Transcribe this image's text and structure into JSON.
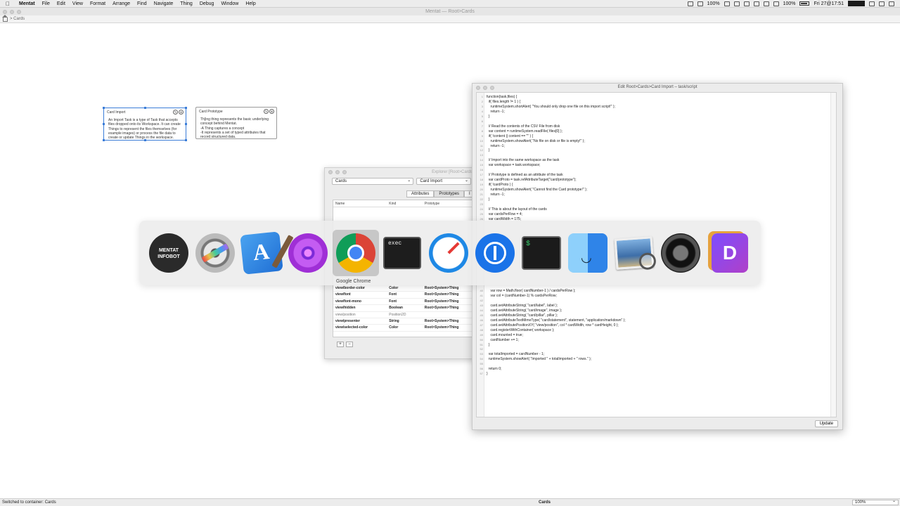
{
  "menubar": {
    "app_name": "Mentat",
    "items": [
      "File",
      "Edit",
      "View",
      "Format",
      "Arrange",
      "Find",
      "Navigate",
      "Thing",
      "Debug",
      "Window",
      "Help"
    ],
    "status": {
      "zoom": "100%",
      "battery": "100%",
      "datetime": "Fri 27@17:51"
    }
  },
  "window": {
    "title": "Mentat — Root>Cards",
    "breadcrumb": "> Cards"
  },
  "cards": [
    {
      "title": "Card Import",
      "body": [
        "An Import Task is a type of Task that accepts",
        "files dropped onto its Workspace. It can create",
        "Things to represent the files themselves (for",
        "example images) or process the file data to",
        "create or update Things in the workspace."
      ]
    },
    {
      "title": "Card Prototype",
      "body": [
        "Th[ing thing represents the basic underlying",
        "concept behind Mentat.",
        "-A Thing captures a concept",
        "-It represents a set of typed attributes that",
        "record structured data."
      ]
    }
  ],
  "explorer": {
    "title": "Explorer [Root>Cards",
    "select_left": "Cards",
    "select_right": "Card Import",
    "tabs": [
      "Attributes",
      "Prototypes",
      "I"
    ],
    "columns": [
      "Name",
      "Kind",
      "Prototype"
    ],
    "rows": [
      {
        "name": "view/border-color",
        "kind": "Color",
        "proto": "Root>System>Thing",
        "style": "bold"
      },
      {
        "name": "view/font",
        "kind": "Font",
        "proto": "Root>System>Thing",
        "style": "bold"
      },
      {
        "name": "view/font-mono",
        "kind": "Font",
        "proto": "Root>System>Thing",
        "style": "bold"
      },
      {
        "name": "view/hidden",
        "kind": "Boolean",
        "proto": "Root>System>Thing",
        "style": "bold"
      },
      {
        "name": "view/position",
        "kind": "Position2D",
        "proto": "",
        "style": "dim"
      },
      {
        "name": "view/presenter",
        "kind": "String",
        "proto": "Root>System>Thing",
        "style": "bold"
      },
      {
        "name": "view/selected-color",
        "kind": "Color",
        "proto": "Root>System>Thing",
        "style": "bold"
      }
    ],
    "add_label": "+",
    "remove_label": "−"
  },
  "editor": {
    "title": "Edit Root>Cards>Card Import – task/script",
    "lines": [
      {
        "n": "1",
        "t": "function(task,files) {"
      },
      {
        "n": "2",
        "t": "  if( files.length != 1 ) {"
      },
      {
        "n": "3",
        "t": "    runtimeSystem.shortAlert( \"You should only drop one file on this import script!\" );"
      },
      {
        "n": "4",
        "t": "    return -1;"
      },
      {
        "n": "5",
        "t": "  }"
      },
      {
        "n": "6",
        "t": ""
      },
      {
        "n": "7",
        "t": "  // Read the contents of the CSV File from disk"
      },
      {
        "n": "8",
        "t": "  var content = runtimeSystem.readFile( files[0] );"
      },
      {
        "n": "9",
        "t": "  if( !content || content == \"\" ) {"
      },
      {
        "n": "10",
        "t": "    runtimeSystem.showAlert( \"No file on disk or file is empty!\" );"
      },
      {
        "n": "11",
        "t": "    return -1;"
      },
      {
        "n": "12",
        "t": "  }"
      },
      {
        "n": "13",
        "t": ""
      },
      {
        "n": "14",
        "t": "  // Import into the same workspace as the task"
      },
      {
        "n": "15",
        "t": "  var workspace = task.workspace;"
      },
      {
        "n": "16",
        "t": ""
      },
      {
        "n": "17",
        "t": "  // Prototype is defined as an attribute of the task"
      },
      {
        "n": "18",
        "t": "  var cardProto = task.refAttributeTarget(\"card/prototype\");"
      },
      {
        "n": "19",
        "t": "  if( !cardProto ) {"
      },
      {
        "n": "20",
        "t": "    runtimeSystem.showAlert( \"Cannot find the Card prototype!\" );"
      },
      {
        "n": "21",
        "t": "    return -1;"
      },
      {
        "n": "22",
        "t": "  }"
      },
      {
        "n": "23",
        "t": ""
      },
      {
        "n": "24",
        "t": "  // This is about the layout of the cards"
      },
      {
        "n": "25",
        "t": "  var cardsPerRow = 4;"
      },
      {
        "n": "26",
        "t": "  var cardWidth = 175;"
      },
      {
        "n": "40",
        "t": "    var row = Math.floor( cardNumber-1 ) / cardsPerRow );"
      },
      {
        "n": "41",
        "t": "    var col = (cardNumber-1) % cardsPerRow;"
      },
      {
        "n": "42",
        "t": ""
      },
      {
        "n": "43",
        "t": "    card.setAttributeString( \"card/label\", label );"
      },
      {
        "n": "44",
        "t": "    card.setAttributeString( \"card/image\", image );"
      },
      {
        "n": "45",
        "t": "    card.setAttributeString( \"card/pillar\", pillar );"
      },
      {
        "n": "46",
        "t": "    card.setAttributeTextMimeType( \"card/statement\", statement, \"application/markdown\" );"
      },
      {
        "n": "47",
        "t": "    card.setAttributePositionXY( \"view/position\", col * cardWidth, row * cardHeight, 0 );"
      },
      {
        "n": "48",
        "t": "    card.registerWithContainer( workspace );"
      },
      {
        "n": "49",
        "t": "    card.mounted = true;"
      },
      {
        "n": "50",
        "t": "    cardNumber += 1;"
      },
      {
        "n": "51",
        "t": "  }"
      },
      {
        "n": "52",
        "t": ""
      },
      {
        "n": "53",
        "t": "  var totalImported = cardNumber - 1;"
      },
      {
        "n": "54",
        "t": "  runtimeSystem.showAlert( \"Imported \" + totalImported + \" rows.\" );"
      },
      {
        "n": "55",
        "t": ""
      },
      {
        "n": "56",
        "t": "  return 0;"
      },
      {
        "n": "57",
        "t": "}"
      }
    ],
    "update_label": "Update"
  },
  "switcher": {
    "apps": [
      {
        "name": "mentat-infobot",
        "label1": "MENTAT",
        "label2": "INFOBOT"
      },
      {
        "name": "final-cut"
      },
      {
        "name": "xcode"
      },
      {
        "name": "flower-app"
      },
      {
        "name": "google-chrome"
      },
      {
        "name": "exec",
        "label1": "exec"
      },
      {
        "name": "safari"
      },
      {
        "name": "1password"
      },
      {
        "name": "terminal",
        "label1": "$"
      },
      {
        "name": "finder"
      },
      {
        "name": "preview"
      },
      {
        "name": "blurred-app"
      },
      {
        "name": "dash",
        "label1": "D"
      }
    ],
    "selected_label": "Google Chrome"
  },
  "statusbar": {
    "left": "Switched to container: Cards",
    "center": "Cards",
    "zoom": "100%"
  }
}
